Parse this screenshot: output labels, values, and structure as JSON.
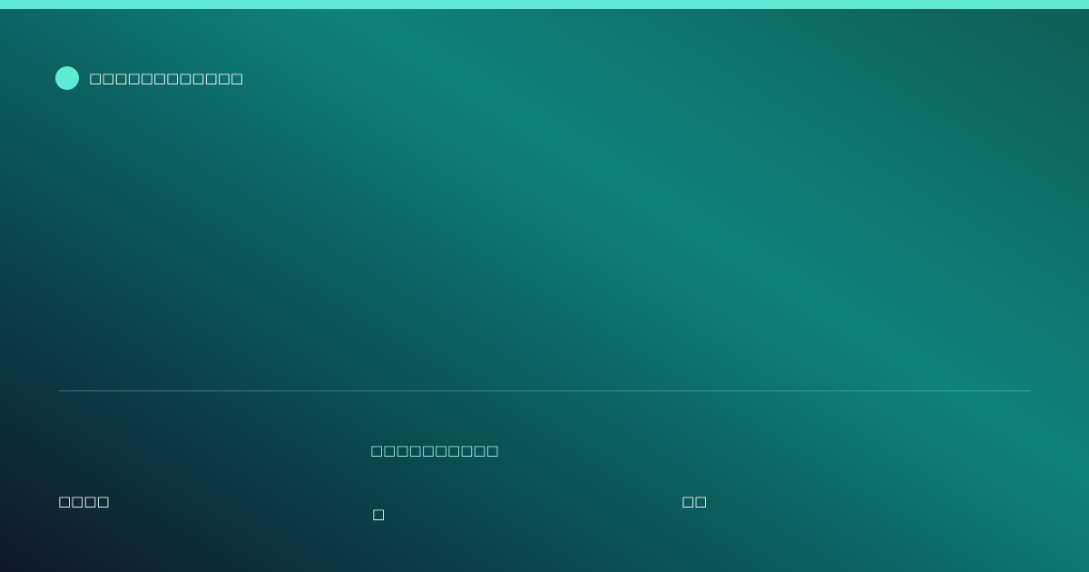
{
  "header": {
    "brand_text": "□□□□□□□□□□□□"
  },
  "footer": {
    "left_text": "□□□□",
    "center_highlight": "□□□□□□□□□□",
    "center_sub": "□",
    "right_text": "□□"
  },
  "colors": {
    "accent": "#5eead4",
    "highlight_text": "#99f6e4",
    "text": "#ffffff",
    "gradient_start": "#0f172a",
    "gradient_mid": "#0e837a",
    "gradient_end": "#105c56"
  },
  "icons": {
    "brand_mark": "circle-dot-icon"
  }
}
